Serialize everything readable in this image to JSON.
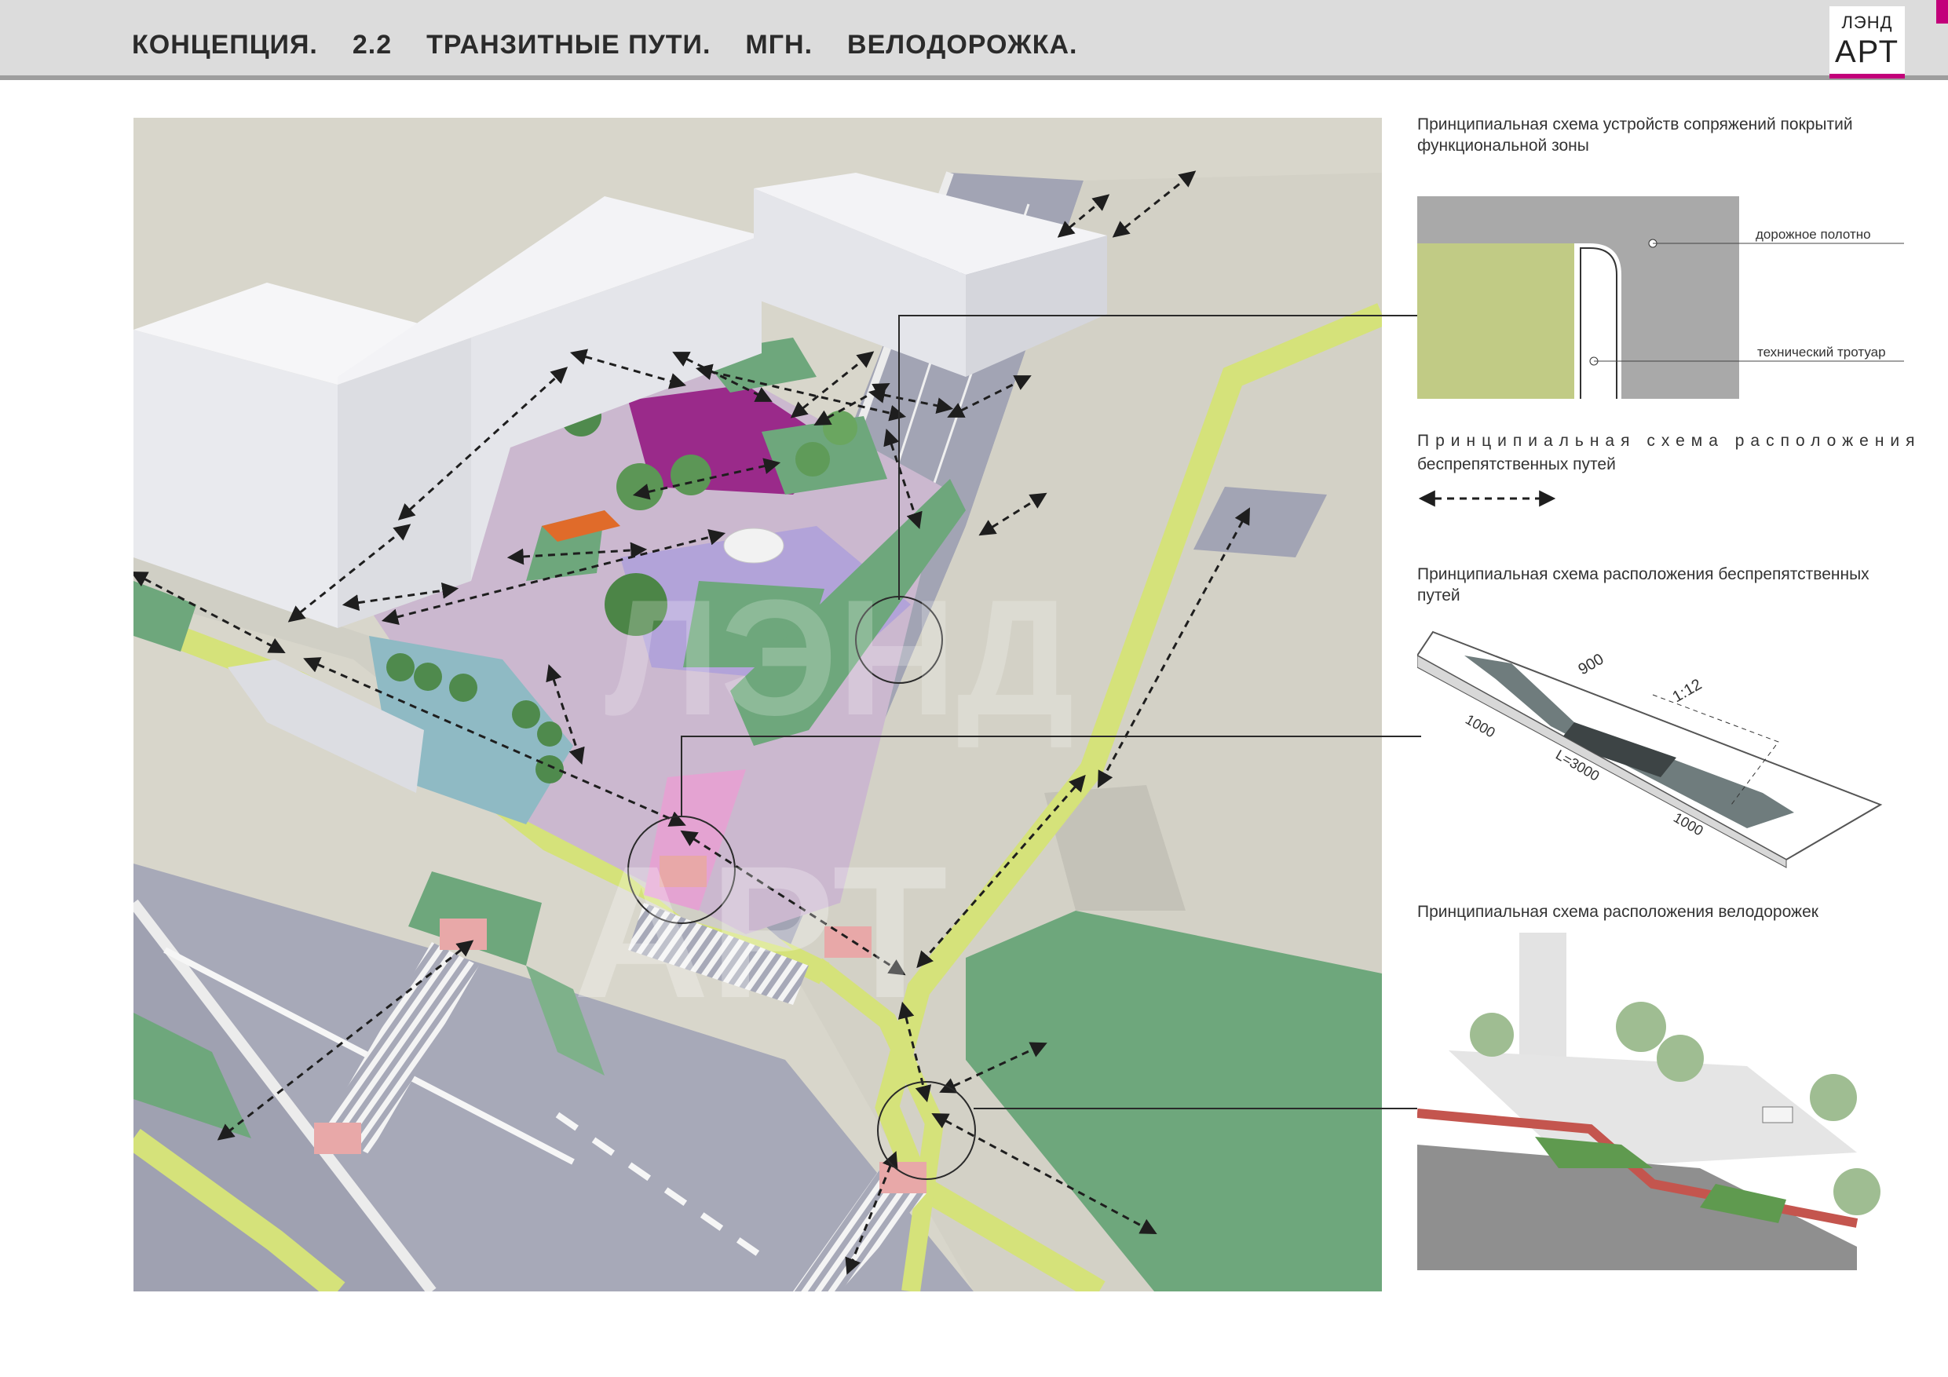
{
  "header": {
    "items": [
      "КОНЦЕПЦИЯ.",
      "2.2",
      "ТРАНЗИТНЫЕ ПУТИ.",
      "МГН.",
      "ВЕЛОДОРОЖКА."
    ]
  },
  "logo": {
    "line1": "ЛЭНД",
    "line2": "АРТ"
  },
  "right_panel": {
    "section1": {
      "title": "Принципиальная схема устройств сопряжений покрытий функциональной зоны",
      "label_road": "дорожное полотно",
      "label_sidewalk": "технический тротуар"
    },
    "section2": {
      "title_line1": "Принципиальная схема расположения",
      "title_line2": "беспрепятственных путей"
    },
    "section3": {
      "title": "Принципиальная схема расположения беспрепятственных путей",
      "dim_900": "900",
      "dim_slope": "1:12",
      "dim_1000a": "1000",
      "dim_3000": "L=3000",
      "dim_1000b": "1000"
    },
    "section4": {
      "title": "Принципиальная схема расположения велодорожек"
    }
  },
  "colors": {
    "accent": "#c2007a",
    "road": "#a7a9b8",
    "grass": "#6ea77c",
    "bike_lane": "#d5e27a",
    "crossing": "#e8a8a8",
    "plaza": "#cbb8cf",
    "sand": "#d8d6cb"
  }
}
